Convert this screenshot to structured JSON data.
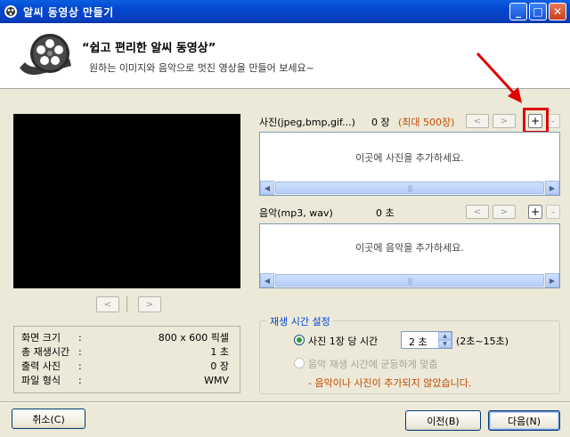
{
  "window": {
    "title": "알씨 동영상 만들기",
    "controls": {
      "minimize": "_",
      "maximize": "□",
      "close": "✕"
    }
  },
  "header": {
    "title": "“쉽고 편리한 알씨 동영상”",
    "subtitle": "원하는 이미지와 음악으로 멋진 영상을 만들어 보세요~",
    "icon": "film-reel-icon"
  },
  "preview": {
    "prev_label": "<",
    "next_label": ">"
  },
  "info": {
    "rows": [
      {
        "label": "화면 크기",
        "colon": ":",
        "value": "800 x 600 픽셀"
      },
      {
        "label": "총 재생시간",
        "colon": ":",
        "value": "1 초"
      },
      {
        "label": "출력 사진",
        "colon": ":",
        "value": "0 장"
      },
      {
        "label": "파일 형식",
        "colon": ":",
        "value": "WMV"
      }
    ]
  },
  "photos": {
    "label": "사진(jpeg,bmp,gif...)",
    "count": "0 장",
    "max": "(최대 500장)",
    "prev_label": "<",
    "next_label": ">",
    "add_label": "+",
    "remove_label": "-",
    "placeholder": "이곳에 사진을 추가하세요."
  },
  "music": {
    "label": "음악(mp3, wav)",
    "count": "0 초",
    "prev_label": "<",
    "next_label": ">",
    "add_label": "+",
    "remove_label": "-",
    "placeholder": "이곳에 음악을 추가하세요."
  },
  "playback": {
    "legend": "재생 시간 설정",
    "option1_label": "사진 1장 당 시간",
    "option1_value": "2 초",
    "option1_range": "(2초~15초)",
    "option2_label": "음악 재생 시간에 균등하게 맞춤",
    "warning": "- 음악이나 사진이 추가되지 않았습니다.",
    "warning_color": "#c04a00"
  },
  "footer": {
    "cancel_label": "취소(C)",
    "prev_label": "이전(B)",
    "next_label": "다음(N)"
  },
  "scroll": {
    "left": "◀",
    "right": "▶",
    "grip": "|||"
  },
  "spin": {
    "up": "▲",
    "down": "▼"
  }
}
